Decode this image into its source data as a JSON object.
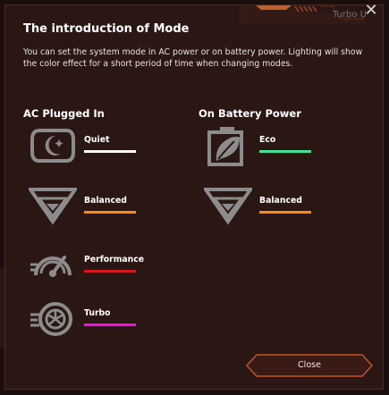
{
  "window": {
    "tab_hint": "Turbo U"
  },
  "dialog": {
    "title": "The introduction of Mode",
    "description": "You can set the system mode in AC power or on battery power. Lighting will show the color effect for a short period of time when changing modes.",
    "close_label": "Close"
  },
  "ac": {
    "heading": "AC Plugged In",
    "modes": [
      {
        "label": "Quiet",
        "color": "#ffffff",
        "icon": "moon-stars-icon"
      },
      {
        "label": "Balanced",
        "color": "#ff8a1f",
        "icon": "balanced-triangle-icon"
      },
      {
        "label": "Performance",
        "color": "#e3121b",
        "icon": "gauge-icon"
      },
      {
        "label": "Turbo",
        "color": "#e51bd0",
        "icon": "turbo-fan-icon"
      }
    ]
  },
  "battery": {
    "heading": "On Battery Power",
    "modes": [
      {
        "label": "Eco",
        "color": "#3ee592",
        "icon": "eco-battery-leaf-icon"
      },
      {
        "label": "Balanced",
        "color": "#ff8a1f",
        "icon": "balanced-triangle-icon"
      }
    ]
  },
  "colors": {
    "background": "#1a0f0c",
    "dialog": "#2a1714",
    "accent": "#c1532f"
  }
}
